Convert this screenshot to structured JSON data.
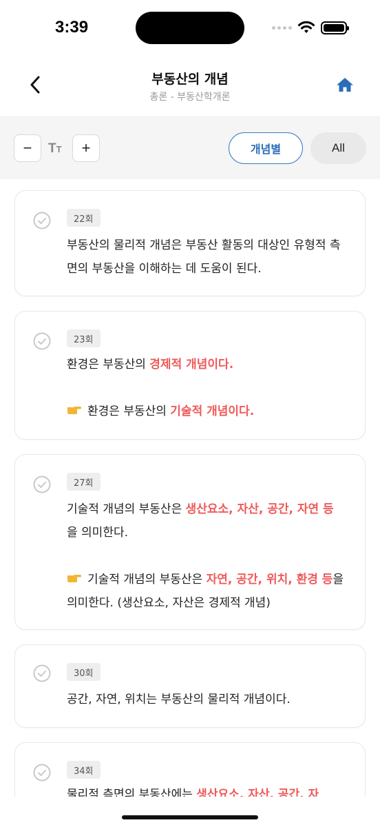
{
  "status_bar": {
    "time": "3:39"
  },
  "header": {
    "title": "부동산의 개념",
    "subtitle": "총론 - 부동산학개론"
  },
  "toolbar": {
    "font_decrease": "−",
    "font_increase": "+",
    "font_size_icon_big": "T",
    "font_size_icon_small": "T",
    "filter_concept_label": "개념별",
    "filter_all_label": "All"
  },
  "colors": {
    "accent": "#2c6db8",
    "highlight": "#ef5a5a",
    "home_icon": "#2c6db8"
  },
  "icons": {
    "back": "chevron-left-icon",
    "home": "home-icon",
    "check": "check-circle-icon",
    "pointer": "pointing-hand-icon"
  },
  "cards": [
    {
      "badge": "22회",
      "text": "부동산의 물리적 개념은 부동산 활동의 대상인 유형적 측면의 부동산을 이해하는 데 도움이 된다."
    },
    {
      "badge": "23회",
      "line1_pre": "환경은 부동산의 ",
      "line1_hl": "경제적 개념이다.",
      "line2_pre": "환경은 부동산의 ",
      "line2_hl": "기술적 개념이다."
    },
    {
      "badge": "27회",
      "p1_pre": "기술적 개념의 부동산은 ",
      "p1_hl": "생산요소, 자산, 공간, 자연 등",
      "p1_post": "을 의미한다.",
      "p2_pre": "기술적 개념의 부동산은 ",
      "p2_hl": "자연, 공간, 위치, 환경 등",
      "p2_post": "을 의미한다. (생산요소, 자산은 경제적 개념)"
    },
    {
      "badge": "30회",
      "text": "공간, 자연, 위치는 부동산의 물리적 개념이다."
    },
    {
      "badge": "34회",
      "text_pre": "물리적 측면의 부동산에는 ",
      "text_hl": "생산요소, 자산, 공간, 자"
    }
  ]
}
